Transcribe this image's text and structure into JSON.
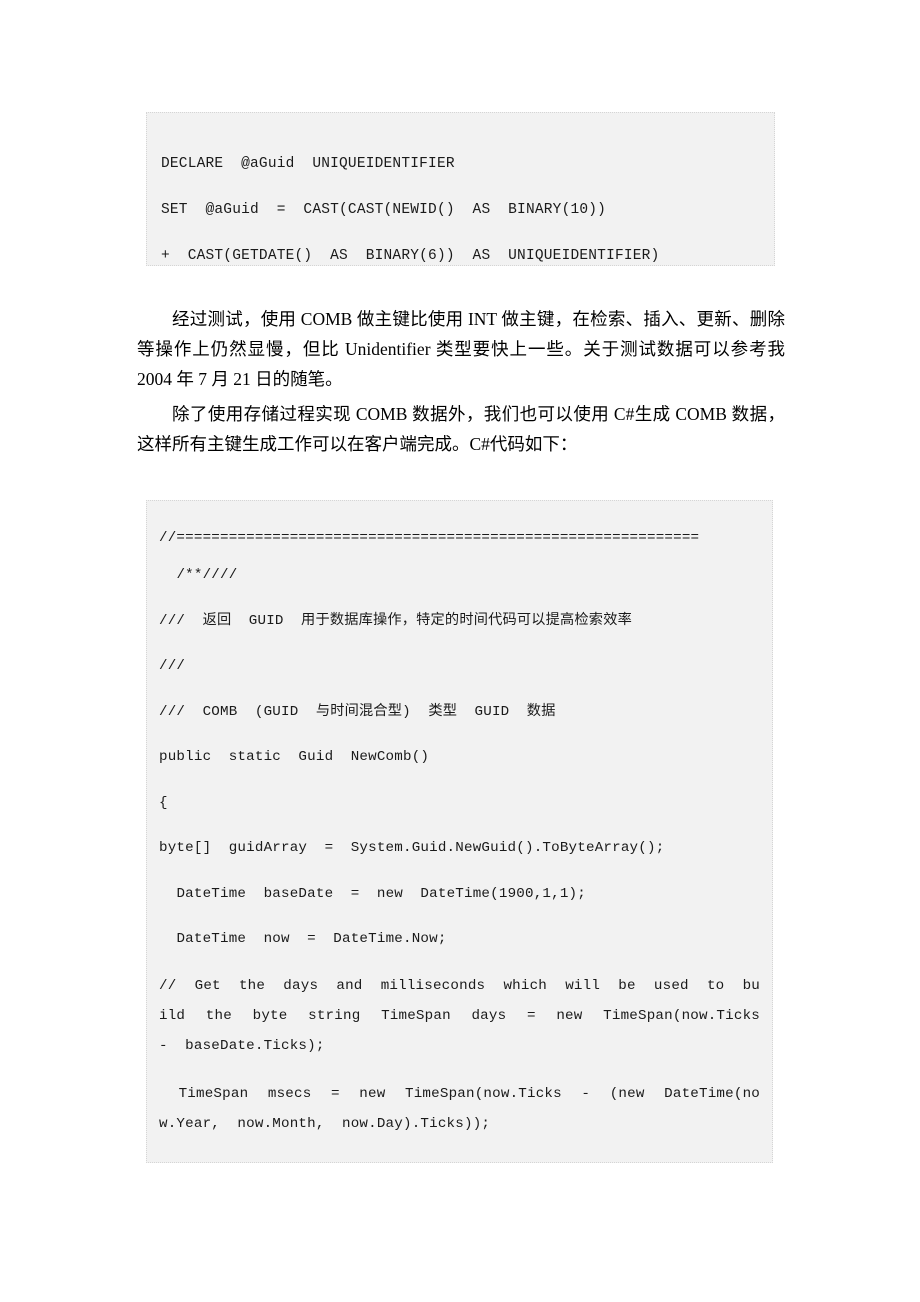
{
  "document": {
    "language": "zh-CN",
    "page_background": "#ffffff",
    "code_block_background": "#f2f2f2",
    "code_block_border_color": "#d5d5d5"
  },
  "sql_code_block": {
    "language": "SQL",
    "lines": [
      "DECLARE  @aGuid  UNIQUEIDENTIFIER",
      "SET  @aGuid  =  CAST(CAST(NEWID()  AS  BINARY(10))",
      "+  CAST(GETDATE()  AS  BINARY(6))  AS  UNIQUEIDENTIFIER)"
    ]
  },
  "paragraphs": {
    "test_results": "经过测试，使用 COMB 做主键比使用 INT 做主键，在检索、插入、更新、删除等操作上仍然显慢，但比 Unidentifier 类型要快上一些。关于测试数据可以参考我 2004 年 7 月 21 日的随笔。",
    "csharp_intro": "除了使用存储过程实现 COMB 数据外，我们也可以使用 C#生成 COMB 数据，这样所有主键生成工作可以在客户端完成。C#代码如下："
  },
  "csharp_code_block": {
    "language": "C#",
    "lines": [
      "//============================================================",
      "  /**////",
      "///  返回  GUID  用于数据库操作，特定的时间代码可以提高检索效率",
      "///",
      "///  COMB  (GUID  与时间混合型)  类型  GUID  数据",
      "public  static  Guid  NewComb()",
      "{",
      "byte[]  guidArray  =  System.Guid.NewGuid().ToByteArray();",
      "  DateTime  baseDate  =  new  DateTime(1900,1,1);",
      "  DateTime  now  =  DateTime.Now;",
      "//  Get  the  days  and  milliseconds  which  will  be  used  to  build  the  byte  string  TimeSpan  days  =  new  TimeSpan(now.Ticks  -  baseDate.Ticks);",
      "  TimeSpan  msecs  =  new  TimeSpan(now.Ticks  -  (new  DateTime(now.Year,  now.Month,  now.Day).Ticks));"
    ]
  }
}
